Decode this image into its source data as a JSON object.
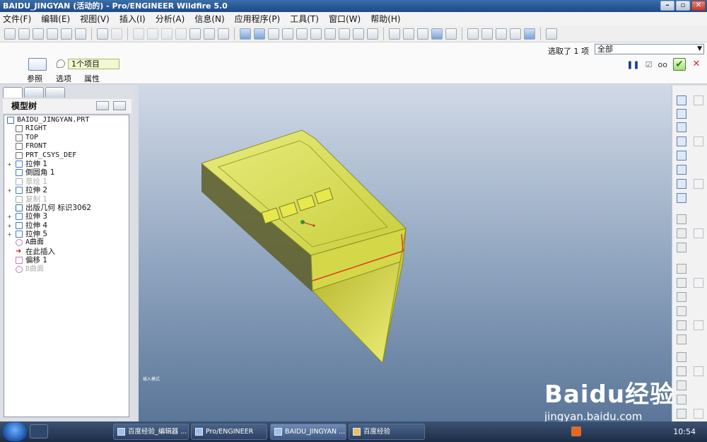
{
  "window": {
    "title": "BAIDU_JINGYAN (活动的) - Pro/ENGINEER Wildfire 5.0"
  },
  "menu": [
    "文件(F)",
    "编辑(E)",
    "视图(V)",
    "插入(I)",
    "分析(A)",
    "信息(N)",
    "应用程序(P)",
    "工具(T)",
    "窗口(W)",
    "帮助(H)"
  ],
  "dashboard": {
    "collector_value": "1个项目",
    "tabs": [
      "参照",
      "选项",
      "属性"
    ],
    "selection_label": "选取了 1 项",
    "filter_value": "全部"
  },
  "tree": {
    "header": "模型树",
    "items": [
      {
        "label": "BAIDU_JINGYAN.PRT",
        "icon": "part-icon",
        "exp": "",
        "dim": false
      },
      {
        "label": "RIGHT",
        "icon": "datum-plane-icon",
        "exp": "",
        "dim": false
      },
      {
        "label": "TOP",
        "icon": "datum-plane-icon",
        "exp": "",
        "dim": false
      },
      {
        "label": "FRONT",
        "icon": "datum-plane-icon",
        "exp": "",
        "dim": false
      },
      {
        "label": "PRT_CSYS_DEF",
        "icon": "csys-icon",
        "exp": "",
        "dim": false
      },
      {
        "label": "拉伸 1",
        "icon": "extrude-icon",
        "exp": "+",
        "dim": false
      },
      {
        "label": "倒圆角 1",
        "icon": "round-icon",
        "exp": "",
        "dim": false
      },
      {
        "label": "草绘 1",
        "icon": "sketch-icon",
        "exp": "",
        "dim": true
      },
      {
        "label": "拉伸 2",
        "icon": "extrude-icon",
        "exp": "+",
        "dim": false
      },
      {
        "label": "复制 1",
        "icon": "copy-icon",
        "exp": "",
        "dim": true
      },
      {
        "label": "出版几何 标识3062",
        "icon": "publish-geometry-icon",
        "exp": "",
        "dim": false
      },
      {
        "label": "拉伸 3",
        "icon": "extrude-icon",
        "exp": "+",
        "dim": false
      },
      {
        "label": "拉伸 4",
        "icon": "extrude-icon",
        "exp": "+",
        "dim": false
      },
      {
        "label": "拉伸 5",
        "icon": "extrude-icon",
        "exp": "+",
        "dim": false
      },
      {
        "label": "A曲面",
        "icon": "surface-icon",
        "exp": "",
        "dim": false
      },
      {
        "label": "在此插入",
        "icon": "insert-here-arrow-icon",
        "exp": "",
        "dim": false
      },
      {
        "label": "偏移 1",
        "icon": "offset-icon",
        "exp": "",
        "dim": false
      },
      {
        "label": "B曲面",
        "icon": "surface-icon",
        "exp": "",
        "dim": true
      }
    ]
  },
  "viewport": {
    "status": "插入模式"
  },
  "watermark": {
    "line1": "Baidu经验",
    "line2": "jingyan.baidu.com"
  },
  "taskbar": {
    "tasks": [
      "百度经验_编辑器 ...",
      "Pro/ENGINEER",
      "BAIDU_JINGYAN ...",
      "百度经验"
    ],
    "clock": "10:54"
  },
  "colors": {
    "model_fill": "#d8dc46",
    "model_edge": "#a3a525",
    "viewport_top": "#d0d9e6",
    "viewport_bottom": "#5a7698"
  }
}
